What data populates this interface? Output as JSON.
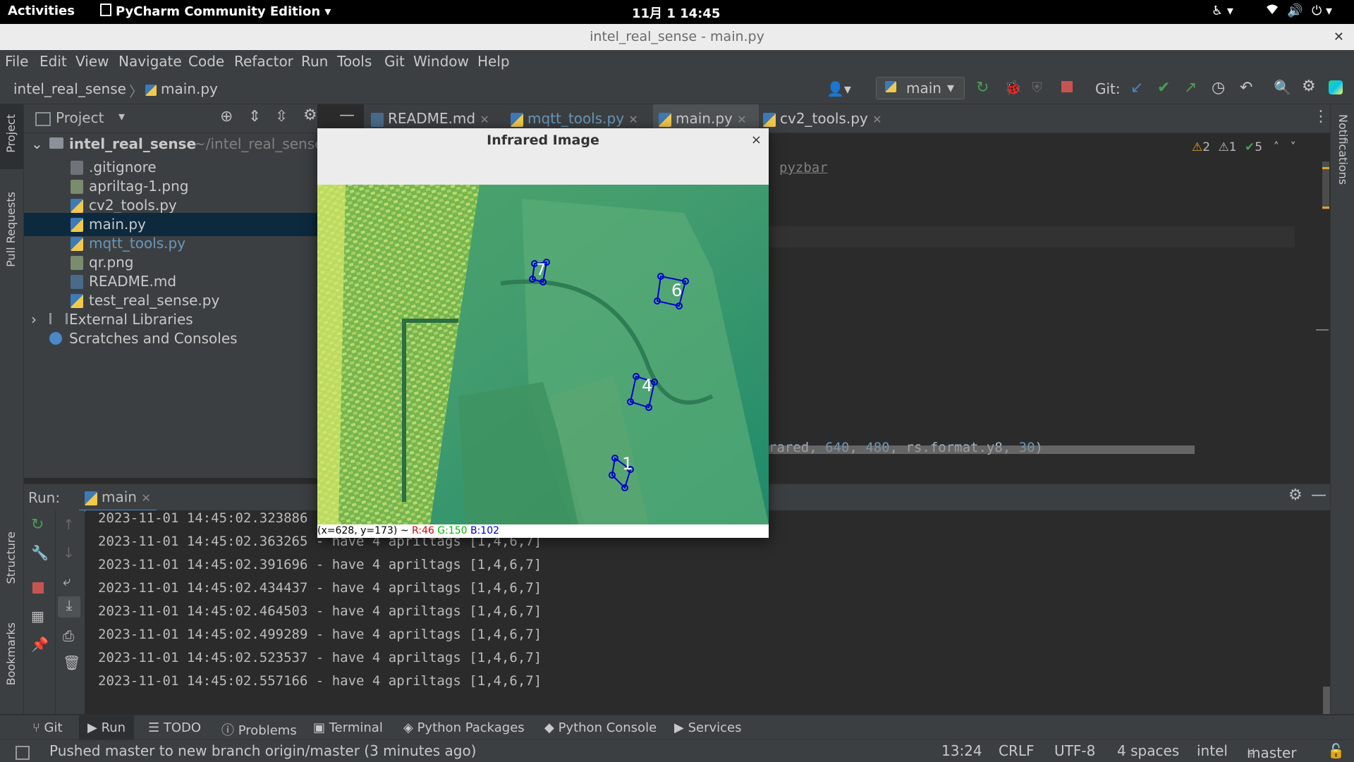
{
  "system_bar": {
    "activities": "Activities",
    "app_name": "PyCharm Community Edition",
    "clock": "11月 1  14:45"
  },
  "window": {
    "title": "intel_real_sense - main.py"
  },
  "menu": [
    "File",
    "Edit",
    "View",
    "Navigate",
    "Code",
    "Refactor",
    "Run",
    "Tools",
    "Git",
    "Window",
    "Help"
  ],
  "navbar": {
    "project": "intel_real_sense",
    "file": "main.py",
    "run_config": "main",
    "git_label": "Git:"
  },
  "project_panel": {
    "title": "Project",
    "root_name": "intel_real_sense",
    "root_path": "~/intel_real_sense",
    "files": [
      ".gitignore",
      "apriltag-1.png",
      "cv2_tools.py",
      "main.py",
      "mqtt_tools.py",
      "qr.png",
      "README.md",
      "test_real_sense.py"
    ],
    "external_libraries": "External Libraries",
    "scratches": "Scratches and Consoles"
  },
  "tabs": [
    "README.md",
    "mqtt_tools.py",
    "main.py",
    "cv2_tools.py"
  ],
  "editor": {
    "inspection_warn": "2",
    "inspection_weak": "1",
    "inspection_ok": "5",
    "code_fragment_1": "pyzbar",
    "code_fragment_2_a": "rared, ",
    "code_fragment_2_b": "640",
    "code_fragment_2_c": ", ",
    "code_fragment_2_d": "480",
    "code_fragment_2_e": ", rs.format.y8, ",
    "code_fragment_2_f": "30",
    "code_fragment_2_g": ")"
  },
  "run_panel": {
    "label": "Run:",
    "config": "main",
    "log_lines": [
      "2023-11-01 14:45:02.323886 - have 4 apriltags [1,4,6,7]",
      "2023-11-01 14:45:02.363265 - have 4 apriltags [1,4,6,7]",
      "2023-11-01 14:45:02.391696 - have 4 apriltags [1,4,6,7]",
      "2023-11-01 14:45:02.434437 - have 4 apriltags [1,4,6,7]",
      "2023-11-01 14:45:02.464503 - have 4 apriltags [1,4,6,7]",
      "2023-11-01 14:45:02.499289 - have 4 apriltags [1,4,6,7]",
      "2023-11-01 14:45:02.523537 - have 4 apriltags [1,4,6,7]",
      "2023-11-01 14:45:02.557166 - have 4 apriltags [1,4,6,7]"
    ]
  },
  "infrared_window": {
    "title": "Infrared Image",
    "close": "×",
    "tag_labels": [
      "7",
      "6",
      "4",
      "1"
    ],
    "status_coords": "(x=628, y=173) ~ ",
    "status_r": "R:46",
    "status_g": "G:150",
    "status_b": "B:102"
  },
  "side_labels": {
    "project": "Project",
    "pull_requests": "Pull Requests",
    "structure": "Structure",
    "bookmarks": "Bookmarks",
    "notifications": "Notifications"
  },
  "tool_tabs": [
    "Git",
    "Run",
    "TODO",
    "Problems",
    "Terminal",
    "Python Packages",
    "Python Console",
    "Services"
  ],
  "status_bar": {
    "message": "Pushed master to new branch origin/master (3 minutes ago)",
    "position": "13:24",
    "line_ending": "CRLF",
    "encoding": "UTF-8",
    "indent": "4 spaces",
    "interpreter": "intel",
    "branch": "master"
  },
  "colors": {
    "accent": "#4a88c7",
    "selection": "#0d293e",
    "run_green": "#499c54",
    "stop_red": "#c75450",
    "modified_blue": "#6897bb"
  }
}
